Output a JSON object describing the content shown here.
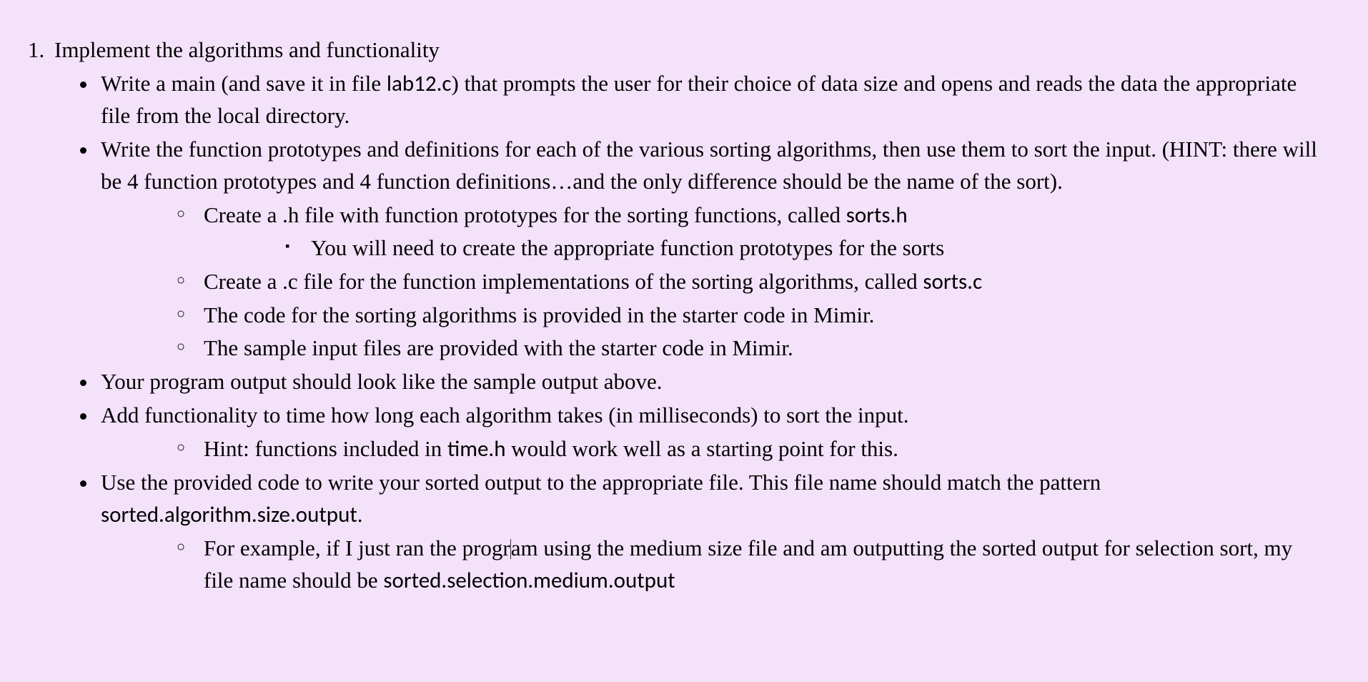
{
  "list": {
    "item1": "Implement the algorithms and functionality",
    "bullets": [
      {
        "text_a": "Write a main (and save it in file ",
        "code_a": "lab12.c",
        "text_b": ") that prompts the user for their choice of data size and opens and reads the data the appropriate file from the local directory."
      },
      {
        "text_a": "Write the function prototypes and definitions for each of the various sorting algorithms, then use them to sort the input. (HINT: there will be 4 function prototypes and 4 function definitions…and the only difference should be the name of the sort).",
        "sub": [
          {
            "text_a": "Create a .h file with function prototypes for the sorting functions, called ",
            "code_a": "sorts.h",
            "sub": [
              {
                "text_a": "You will need to create the appropriate function prototypes for the sorts"
              }
            ]
          },
          {
            "text_a": "Create a .c file for the function implementations of the sorting algorithms, called ",
            "code_a": "sorts.c"
          },
          {
            "text_a": "The code for the sorting algorithms is provided in the starter code in Mimir."
          },
          {
            "text_a": "The sample input files are provided with the starter code in Mimir."
          }
        ]
      },
      {
        "text_a": "Your program output should look like the sample output above."
      },
      {
        "text_a": "Add functionality to time how long each algorithm takes (in milliseconds) to sort the input.",
        "sub": [
          {
            "text_a": "Hint: functions included in ",
            "code_a": "time.h",
            "text_b": " would work well as a starting point for this."
          }
        ]
      },
      {
        "text_a": "Use the provided code to write your sorted output to the appropriate file. This file name should match the pattern ",
        "code_a": "sorted.algorithm.size.output",
        "text_b": ".",
        "sub": [
          {
            "text_a": "For example, if I just ran the progr",
            "text_a2": "am using the medium size file and am outputting the sorted output for selection sort, my file name should be ",
            "code_a": "sorted.selection.medium.output"
          }
        ]
      }
    ]
  }
}
